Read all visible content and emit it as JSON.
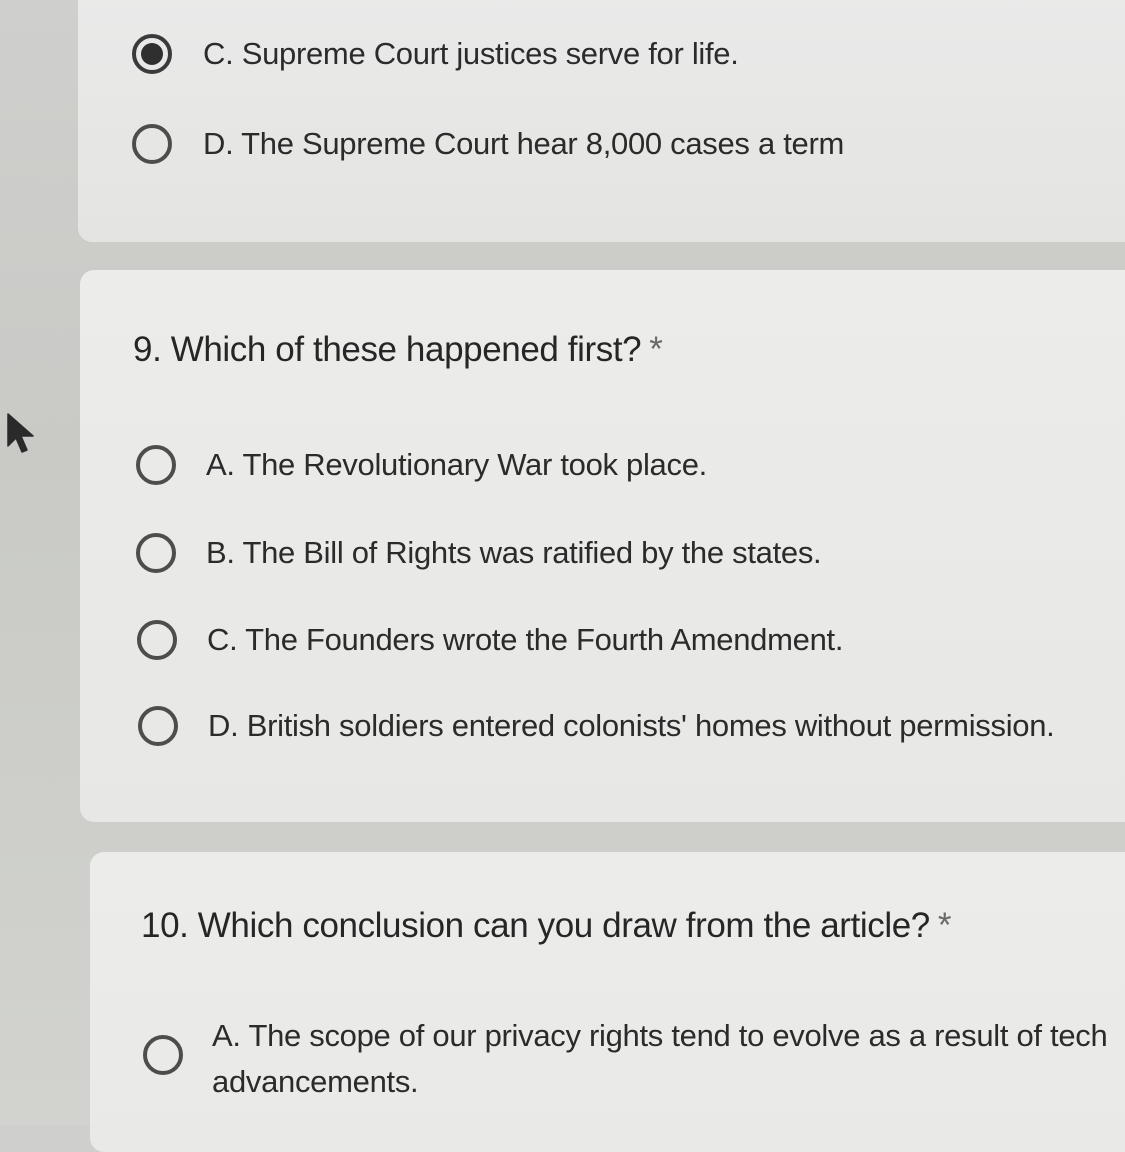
{
  "previous_question": {
    "options": [
      {
        "label": "C. Supreme Court justices serve for life.",
        "selected": true
      },
      {
        "label": "D. The Supreme Court hear 8,000 cases a term",
        "selected": false
      }
    ]
  },
  "question9": {
    "title": "9. Which of these happened first?",
    "required_marker": "*",
    "options": [
      {
        "label": "A. The Revolutionary War took place."
      },
      {
        "label": "B. The Bill of Rights was ratified by the states."
      },
      {
        "label": "C. The Founders wrote the Fourth Amendment."
      },
      {
        "label": "D. British soldiers entered colonists' homes without permission."
      }
    ]
  },
  "question10": {
    "title": "10. Which conclusion can you draw from the article?",
    "required_marker": "*",
    "options": [
      {
        "label_line1": "A. The scope of our privacy rights tend to evolve as a result of tech",
        "label_line2": "advancements."
      }
    ]
  },
  "cursor": {
    "icon": "arrow-cursor-icon"
  }
}
